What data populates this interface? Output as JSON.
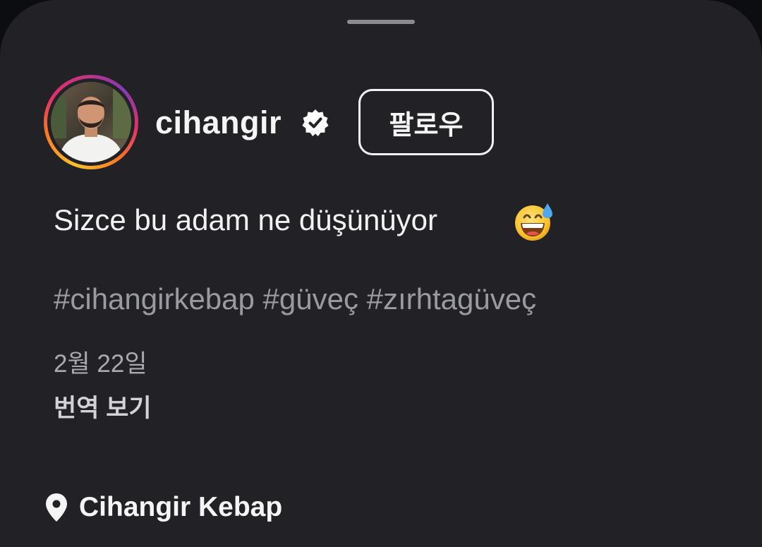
{
  "post": {
    "username": "cihangir",
    "follow_label": "팔로우",
    "caption": "Sizce bu adam ne düşünüyor",
    "caption_emoji_icon": "grinning-sweat-face-icon",
    "hashtags": "#cihangirkebap #güveç #zırhtagüveç",
    "date": "2월 22일",
    "translate_label": "번역 보기",
    "location_icon": "location-pin-icon",
    "location": "Cihangir Kebap"
  },
  "icons": {
    "verified": "verified-badge-icon",
    "drag_handle": "drag-handle"
  },
  "colors": {
    "sheet_background": "#222226",
    "primary_text": "#f5f5f5",
    "hashtag_text": "#9a9ba1",
    "date_text": "#a9aab0",
    "story_ring": [
      "#f9c22e",
      "#fa7e1e",
      "#e1306c",
      "#c13584",
      "#833ab4"
    ]
  }
}
